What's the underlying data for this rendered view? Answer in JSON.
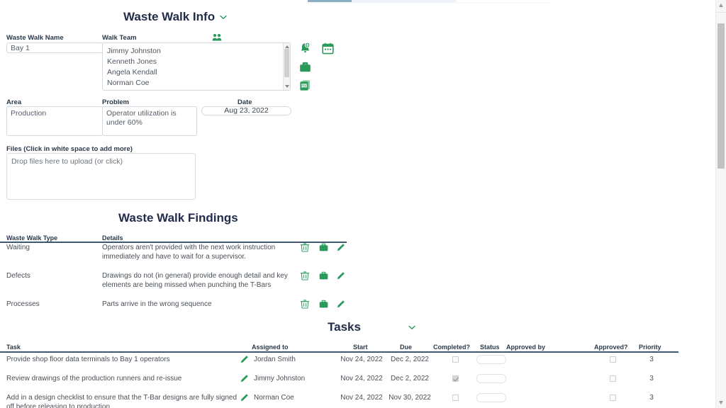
{
  "theme": {
    "accent_green": "#2a9a5b",
    "heading_navy": "#232d4b",
    "rule_color": "#3f5872"
  },
  "sections": {
    "info": {
      "title": "Waste Walk Info",
      "collapse_icon": "chevron-down-icon"
    },
    "findings": {
      "title": "Waste Walk Findings"
    },
    "tasks": {
      "title": "Tasks",
      "collapse_icon": "chevron-down-icon"
    }
  },
  "info_form": {
    "waste_walk_name": {
      "label": "Waste Walk Name",
      "value": "Bay 1"
    },
    "walk_team": {
      "label": "Walk Team",
      "people_icon": "people-group-icon",
      "members": [
        "Jimmy Johnston",
        "Kenneth Jones",
        "Angela Kendall",
        "Norman Coe"
      ]
    },
    "area": {
      "label": "Area",
      "value": "Production"
    },
    "problem": {
      "label": "Problem",
      "value": "Operator utilization is under 60%"
    },
    "date": {
      "label": "Date",
      "value": "Aug 23, 2022"
    },
    "files": {
      "label": "Files (Click in white space to add more)",
      "dropzone_text": "Drop files here to upload (or click)"
    },
    "action_icons": [
      {
        "name": "bell-add-icon",
        "title": "Add reminder"
      },
      {
        "name": "calendar-icon",
        "title": "Calendar"
      },
      {
        "name": "briefcase-icon",
        "title": "Briefcase"
      },
      {
        "name": "pdf-icon",
        "title": "PDF"
      }
    ]
  },
  "findings_table": {
    "columns": [
      "Waste Walk Type",
      "Details"
    ],
    "row_icons": [
      "trash-icon",
      "briefcase-icon",
      "pencil-icon"
    ],
    "rows": [
      {
        "type": "Waiting",
        "details": "Operators aren't provided with the next work instruction immediately and have to wait for a supervisor."
      },
      {
        "type": "Defects",
        "details": "Drawings do not (in general) provide enough detail and key elements are being missed when punching the T-Bars"
      },
      {
        "type": "Processes",
        "details": "Parts arrive in the wrong sequence"
      }
    ]
  },
  "tasks_table": {
    "columns": [
      "Task",
      "Assigned to",
      "Start",
      "Due",
      "Completed?",
      "Status",
      "Approved by",
      "Approved?",
      "Priority"
    ],
    "rows": [
      {
        "task": "Provide shop floor data terminals to Bay 1 operators",
        "edit_icon": "pencil-icon",
        "assigned_to": "Jordan Smith",
        "start": "Nov 24, 2022",
        "due": "Dec 2, 2022",
        "completed": false,
        "status": "",
        "approved_by": "",
        "approved": false,
        "priority": "3"
      },
      {
        "task": "Review drawings of the production runners and re-issue",
        "edit_icon": "pencil-icon",
        "assigned_to": "Jimmy Johnston",
        "start": "Nov 24, 2022",
        "due": "Dec 2, 2022",
        "completed": true,
        "status": "",
        "approved_by": "",
        "approved": false,
        "priority": "3"
      },
      {
        "task": "Add in a design checklist to ensure that the T-Bar designs are fully signed off before releasing to production",
        "edit_icon": "pencil-icon",
        "assigned_to": "Norman Coe",
        "start": "Nov 24, 2022",
        "due": "Nov 30, 2022",
        "completed": false,
        "status": "",
        "approved_by": "",
        "approved": false,
        "priority": "3"
      }
    ]
  }
}
